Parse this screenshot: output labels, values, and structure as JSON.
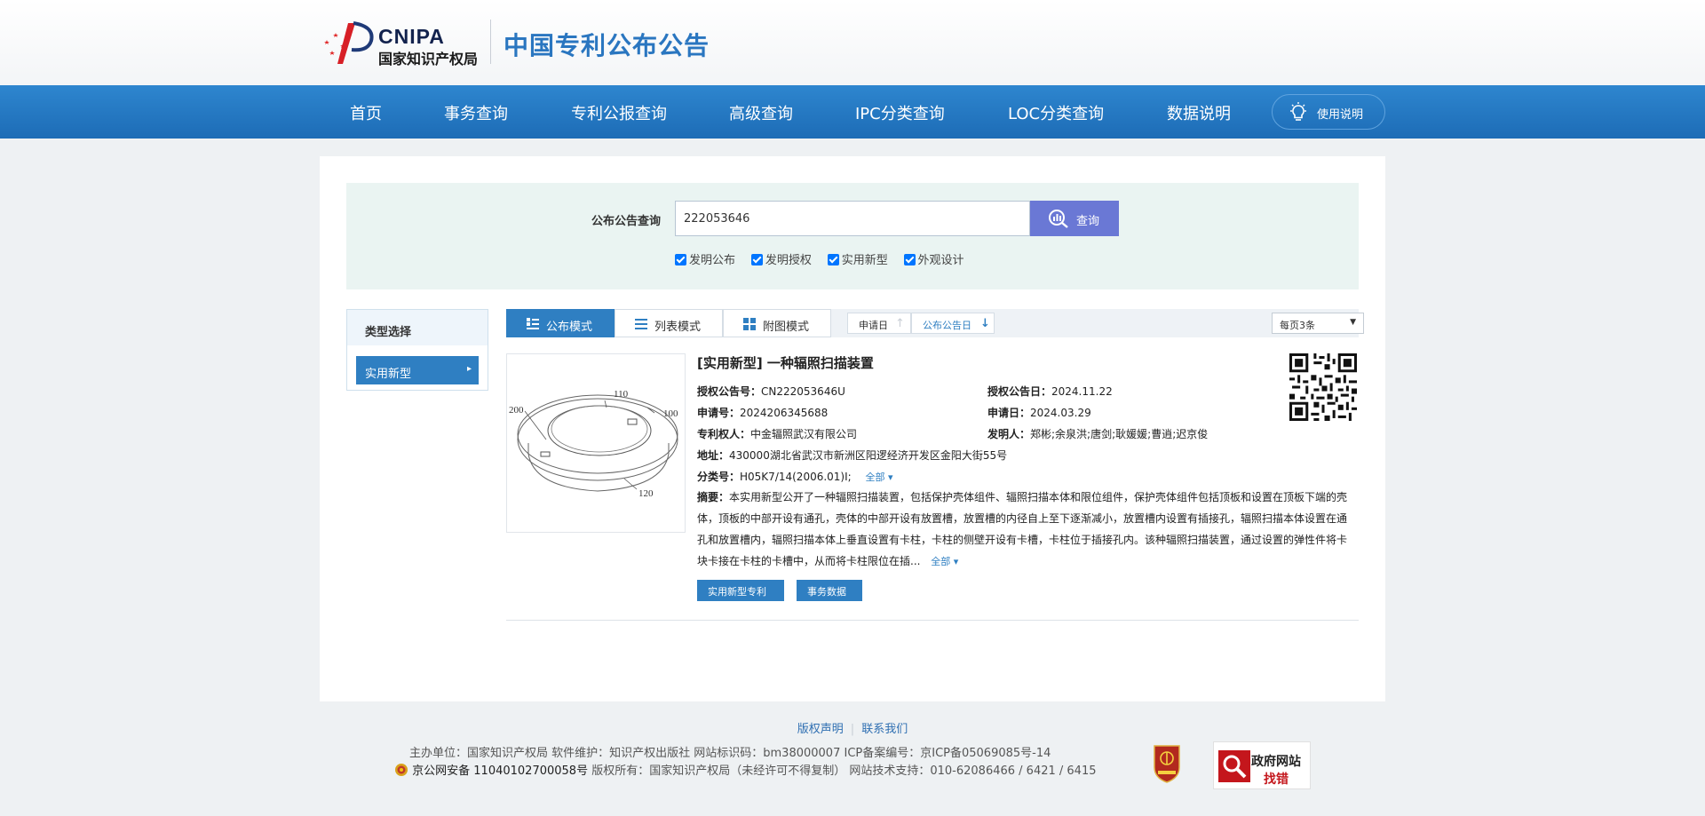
{
  "header": {
    "logo_en": "CNIPA",
    "logo_cn": "国家知识产权局",
    "site_title": "中国专利公布公告"
  },
  "nav": {
    "items": [
      "首页",
      "事务查询",
      "专利公报查询",
      "高级查询",
      "IPC分类查询",
      "LOC分类查询",
      "数据说明"
    ],
    "help_label": "使用说明",
    "help_icon": "lightbulb-icon"
  },
  "search": {
    "label": "公布公告查询",
    "value": "222053646",
    "button_label": "查询",
    "checkboxes": [
      {
        "label": "发明公布",
        "checked": true
      },
      {
        "label": "发明授权",
        "checked": true
      },
      {
        "label": "实用新型",
        "checked": true
      },
      {
        "label": "外观设计",
        "checked": true
      }
    ]
  },
  "sidebar": {
    "title": "类型选择",
    "selected": "实用新型"
  },
  "toolbar": {
    "modes": [
      "公布模式",
      "列表模式",
      "附图模式"
    ],
    "active_mode": "公布模式",
    "sort_apply_date": "申请日",
    "sort_pub_date": "公布公告日",
    "per_page": "每页3条"
  },
  "result": {
    "title": "[实用新型] 一种辐照扫描装置",
    "grant_pub_no_label": "授权公告号：",
    "grant_pub_no": "CN222053646U",
    "grant_pub_date_label": "授权公告日：",
    "grant_pub_date": "2024.11.22",
    "app_no_label": "申请号：",
    "app_no": "2024206345688",
    "app_date_label": "申请日：",
    "app_date": "2024.03.29",
    "patentee_label": "专利权人：",
    "patentee": "中金辐照武汉有限公司",
    "inventor_label": "发明人：",
    "inventors": "郑彬;余泉洪;唐剑;耿媛媛;曹逍;迟京俊",
    "address_label": "地址：",
    "address": "430000湖北省武汉市新洲区阳逻经济开发区金阳大街55号",
    "class_label": "分类号：",
    "class_no": "H05K7/14(2006.01)I;",
    "all_label": "全部",
    "abstract_label": "摘要：",
    "abstract": "本实用新型公开了一种辐照扫描装置，包括保护壳体组件、辐照扫描本体和限位组件，保护壳体组件包括顶板和设置在顶板下端的壳体，顶板的中部开设有通孔，壳体的中部开设有放置槽，放置槽的内径自上至下逐渐减小，放置槽内设置有插接孔，辐照扫描本体设置在通孔和放置槽内，辐照扫描本体上垂直设置有卡柱，卡柱的侧壁开设有卡槽，卡柱位于插接孔内。该种辐照扫描装置，通过设置的弹性件将卡块卡接在卡柱的卡槽中，从而将卡柱限位在插...",
    "buttons": [
      "实用新型专利",
      "事务数据"
    ],
    "figure_labels": [
      "110",
      "100",
      "200",
      "120"
    ]
  },
  "footer": {
    "links": [
      "版权声明",
      "联系我们"
    ],
    "line1": "主办单位：国家知识产权局    软件维护：知识产权出版社    网站标识码：bm38000007    ICP备案编号：京ICP备05069085号-14",
    "line2_police": "京公网安备 11040102700058号",
    "line2_rest": "版权所有：国家知识产权局（未经许可不得复制）    网站技术支持：010-62086466 / 6421 / 6415",
    "badge_l1": "政府网站",
    "badge_l2": "找错"
  }
}
